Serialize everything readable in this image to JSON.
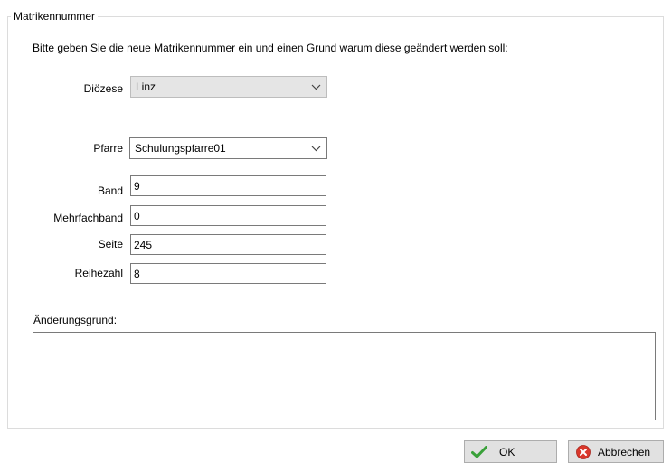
{
  "group": {
    "title": "Matrikennummer"
  },
  "instruction": "Bitte geben Sie die neue Matrikennummer ein und einen Grund warum diese geändert werden soll:",
  "dioezese": {
    "label": "Diözese",
    "value": "Linz"
  },
  "pfarre": {
    "label": "Pfarre",
    "value": "Schulungspfarre01"
  },
  "band": {
    "label": "Band",
    "value": "9"
  },
  "mehrfachband": {
    "label": "Mehrfachband",
    "value": "0"
  },
  "seite": {
    "label": "Seite",
    "value": "245"
  },
  "reihezahl": {
    "label": "Reihezahl",
    "value": "8"
  },
  "aenderungsgrund": {
    "label": "Änderungsgrund:",
    "value": ""
  },
  "buttons": {
    "ok": {
      "label": "OK",
      "icon": "checkmark-icon",
      "color": "#3aa13a"
    },
    "cancel": {
      "label": "Abbrechen",
      "icon": "cancel-icon",
      "color": "#d9372b"
    }
  }
}
